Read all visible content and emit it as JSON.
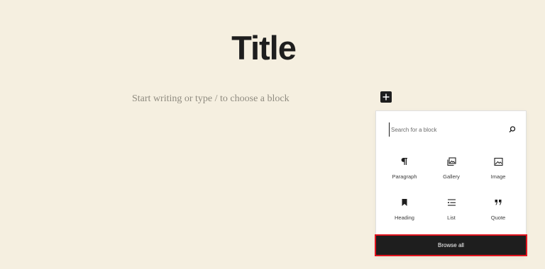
{
  "editor": {
    "title": "Title",
    "paragraph_placeholder": "Start writing or type / to choose a block"
  },
  "inserter": {
    "toggle_icon": "plus-icon",
    "search": {
      "placeholder": "Search for a block",
      "value": "",
      "icon": "search-icon"
    },
    "blocks": [
      {
        "label": "Paragraph",
        "icon": "paragraph-icon"
      },
      {
        "label": "Gallery",
        "icon": "gallery-icon"
      },
      {
        "label": "Image",
        "icon": "image-icon"
      },
      {
        "label": "Heading",
        "icon": "bookmark-icon"
      },
      {
        "label": "List",
        "icon": "list-icon"
      },
      {
        "label": "Quote",
        "icon": "quote-icon"
      }
    ],
    "browse_all_label": "Browse all",
    "highlight_color": "#e0141e"
  },
  "colors": {
    "background": "#f5efe0",
    "text": "#1e1e1e",
    "placeholder": "#8f8b80"
  }
}
